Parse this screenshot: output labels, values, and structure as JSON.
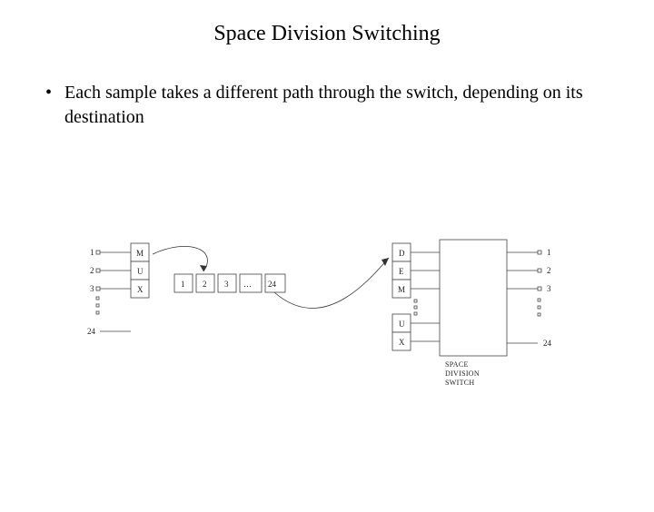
{
  "title": "Space Division Switching",
  "bullet": "Each sample takes a different path through the switch, depending on its destination",
  "left": {
    "inputs": [
      "1",
      "2",
      "3",
      "24"
    ],
    "cells": [
      "M",
      "U",
      "X"
    ]
  },
  "buffer": {
    "cells": [
      "1",
      "2",
      "3",
      "…",
      "24"
    ]
  },
  "right": {
    "cells_top": [
      "D",
      "E",
      "M"
    ],
    "cells_bot": [
      "U",
      "X"
    ],
    "outputs": [
      "1",
      "2",
      "3",
      "24"
    ]
  },
  "switch_label": [
    "SPACE",
    "DIVISION",
    "SWITCH"
  ]
}
